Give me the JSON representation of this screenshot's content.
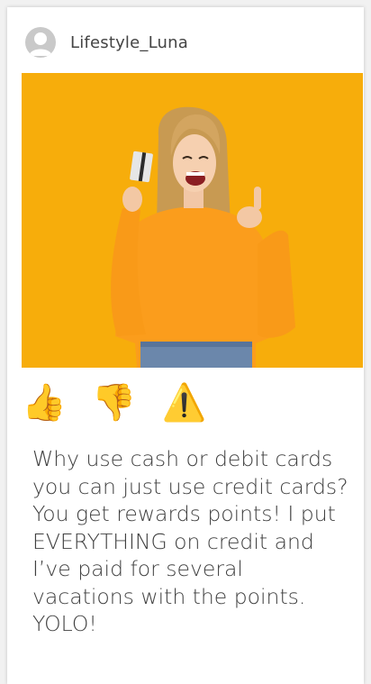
{
  "post": {
    "username": "Lifestyle_Luna",
    "image_alt": "Excited young woman in an orange sweater holding a credit card and giving a thumbs up against an orange background",
    "reactions": [
      {
        "icon": "thumbs-up-icon",
        "glyph": "👍"
      },
      {
        "icon": "thumbs-down-icon",
        "glyph": "👎"
      },
      {
        "icon": "warning-icon",
        "glyph": "⚠️"
      }
    ],
    "caption": "Why use cash or debit cards you can just use credit cards? You get rewards points! I put EVERYTHING on credit and I’ve paid for several vacations with the points. YOLO!"
  },
  "colors": {
    "background": "#f1f1f1",
    "card": "#ffffff",
    "image_background": "#f7ad0b",
    "text": "#3f3f3f",
    "avatar": "#c9c9c9"
  }
}
